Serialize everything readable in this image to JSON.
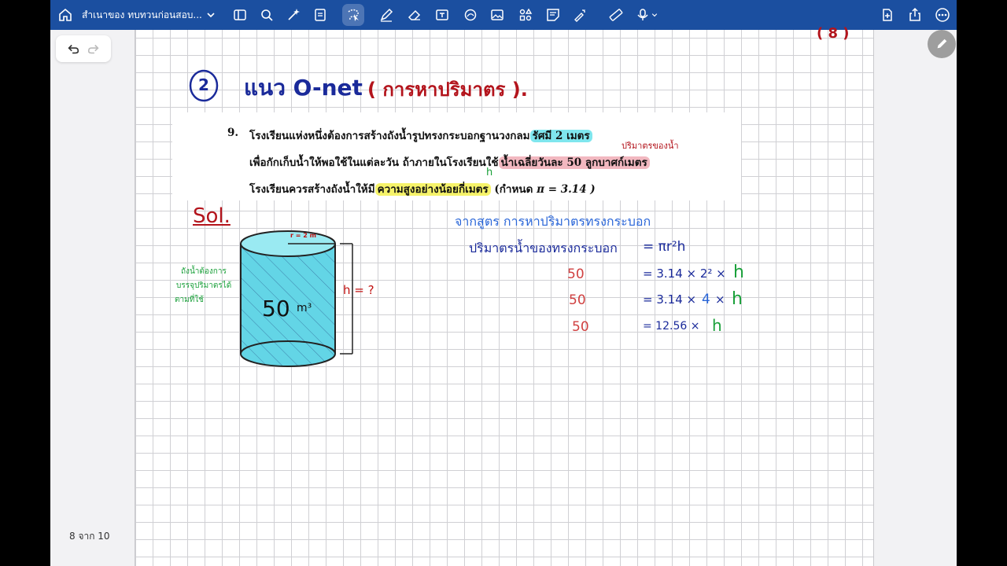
{
  "toolbar": {
    "doc_title": "สำเนาของ ทบทวนก่อนสอบ...",
    "icons": [
      "home-icon",
      "chevron-down-icon",
      "sidebar-icon",
      "search-icon",
      "magic-icon",
      "scan-icon",
      "lasso-icon",
      "pen-icon",
      "eraser-icon",
      "text-icon",
      "shape-icon",
      "image-icon",
      "elements-icon",
      "sticky-note-icon",
      "laser-icon",
      "ruler-icon",
      "mic-icon",
      "new-page-icon",
      "share-icon",
      "more-icon"
    ]
  },
  "page_indicator": "8 จาก 10",
  "problem": {
    "number": "9.",
    "line1_a": "โรงเรียนแห่งหนึ่งต้องการสร้างถังน้ำรูปทรงกระบอกฐานวงกลม",
    "line1_hl": "รัศมี 2 เมตร",
    "line2_a": "เพื่อกักเก็บน้ำให้พอใช้ในแต่ละวัน ถ้าภายในโรงเรียนใช้",
    "line2_hl": "น้ำเฉลี่ยวันละ 50 ลูกบาศก์เมตร",
    "line3_a": "โรงเรียนควรสร้างถังน้ำให้มี",
    "line3_hl": "ความสูงอย่างน้อยกี่เมตร",
    "line3_b": "(กำหนด",
    "line3_pi": "π = 3.14 )"
  },
  "notes": {
    "corner": "( 8 )",
    "header_num": "2",
    "header_title": "แนว O-net",
    "header_sub": "( การหาปริมาตร ).",
    "volume_note": "ปริมาตรของน้ำ",
    "h_note": "h",
    "sol": "Sol.",
    "radius": "r = 2 m",
    "height": "h = ?",
    "cylinder_vol": "50",
    "cylinder_unit": "m³",
    "side_note_1": "ถังน้ำต้องการ",
    "side_note_2": "บรรจุปริมาตรได้",
    "side_note_3": "ตามที่ใช้",
    "formula_title": "จากสูตร การหาปริมาตรทรงกระบอก",
    "formula_lhs": "ปริมาตรน้ำของทรงกระบอก",
    "formula_rhs": "= πr²h",
    "s1_l": "50",
    "s1_r": "= 3.14 × 2² ×",
    "s1_h": "h",
    "s2_l": "50",
    "s2_r": "= 3.14 ×",
    "s2_m": "4",
    "s2_x": "×",
    "s2_h": "h",
    "s3_l": "50",
    "s3_r": "= 12.56 ×",
    "s3_h": "h"
  }
}
